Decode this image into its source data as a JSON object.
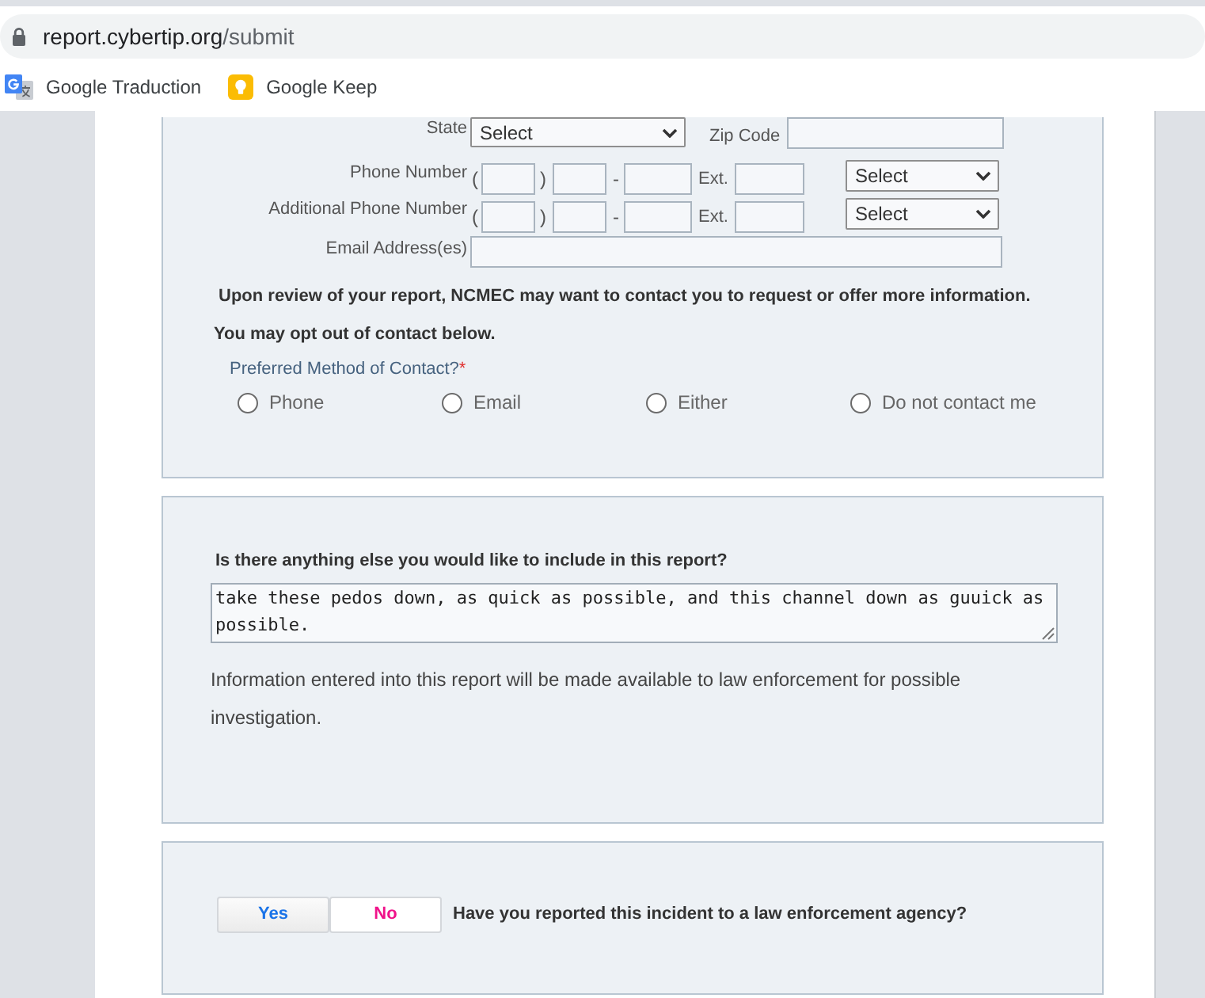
{
  "browser": {
    "url": {
      "host": "report.cybertip.org",
      "path": "/submit"
    },
    "bookmarks": [
      {
        "label": "Google Traduction",
        "kind": "translate"
      },
      {
        "label": "Google Keep",
        "kind": "keep"
      }
    ]
  },
  "contact_panel": {
    "state": {
      "label": "State",
      "value": "Select"
    },
    "zip_code": {
      "label": "Zip Code"
    },
    "phones": [
      {
        "label": "Phone Number",
        "open_paren": "(",
        "close_paren": ")",
        "dash": "-",
        "ext_label": "Ext.",
        "type_value": "Select"
      },
      {
        "label": "Additional Phone Number",
        "open_paren": "(",
        "close_paren": ")",
        "dash": "-",
        "ext_label": "Ext.",
        "type_value": "Select"
      }
    ],
    "email": {
      "label": "Email Address(es)"
    },
    "notices": [
      "Upon review of your report, NCMEC may want to contact you to request or offer more information.",
      "You may opt out of contact below."
    ],
    "contact_method": {
      "label": "Preferred Method of Contact?",
      "required_mark": "*",
      "options": [
        {
          "label": "Phone",
          "selected": false
        },
        {
          "label": "Email",
          "selected": false
        },
        {
          "label": "Either",
          "selected": false
        },
        {
          "label": "Do not contact me",
          "selected": false
        }
      ]
    }
  },
  "comments_panel": {
    "question": "Is there anything else you would like to include in this report?",
    "answer": "take these pedos down, as quick as possible, and this channel down as guuick as possible.",
    "note": "Information entered into this report will be made available to law enforcement for possible investigation."
  },
  "law_enforcement_panel": {
    "buttons": [
      {
        "label": "Yes",
        "kind": "yes"
      },
      {
        "label": "No",
        "kind": "no"
      }
    ],
    "question": "Have you reported this incident to a law enforcement agency?"
  }
}
